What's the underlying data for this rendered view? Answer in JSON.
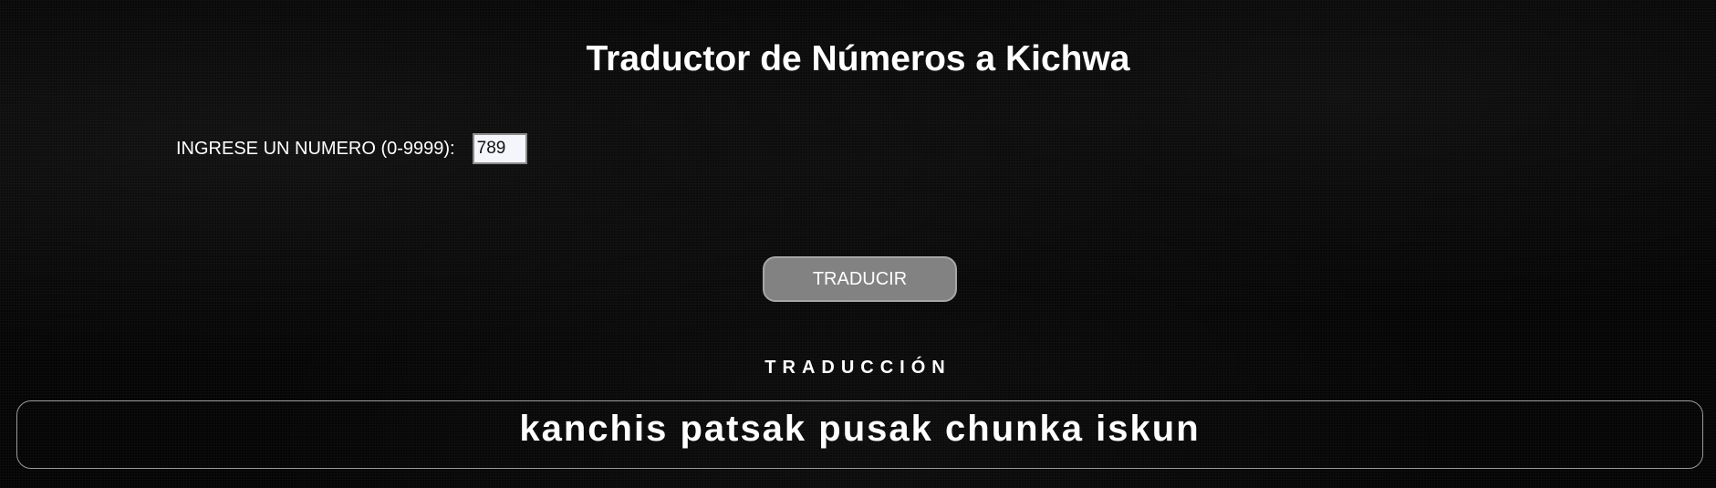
{
  "page": {
    "title": "Traductor de Números a Kichwa"
  },
  "form": {
    "label": "INGRESE UN NUMERO (0-9999):",
    "input_value": "789"
  },
  "actions": {
    "translate_label": "TRADUCIR"
  },
  "result": {
    "heading": "TRADUCCIÓN",
    "text": "kanchis patsak pusak chunka iskun"
  },
  "colors": {
    "background": "#050505",
    "text": "#ffffff",
    "button_bg": "#828282",
    "input_bg": "#f4f6fb",
    "box_border": "#9a9a9a"
  }
}
